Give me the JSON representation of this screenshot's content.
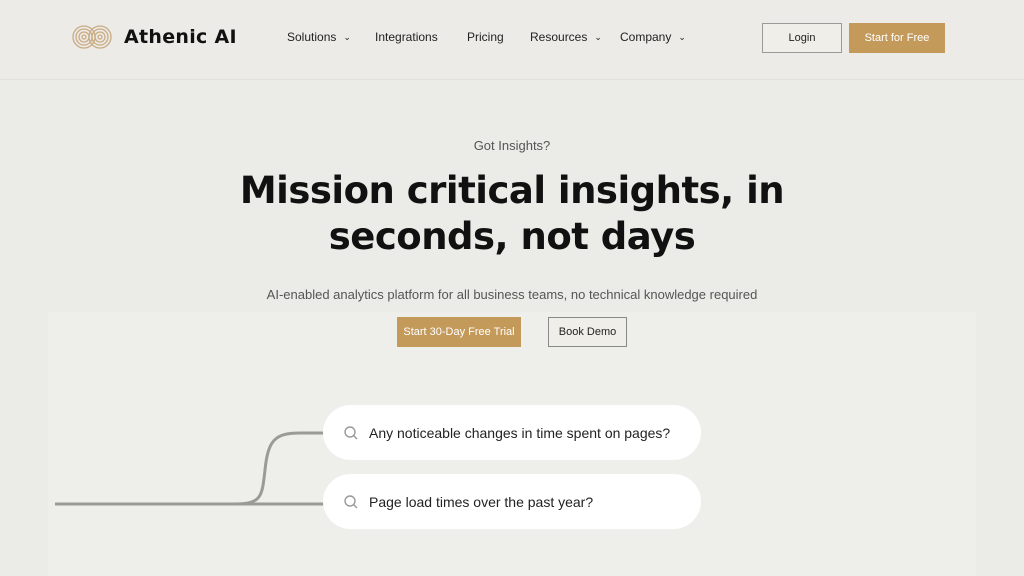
{
  "brand": {
    "name": "Athenic AI",
    "accent": "#c49a5a"
  },
  "nav": [
    {
      "label": "Solutions",
      "dropdown": true
    },
    {
      "label": "Integrations"
    },
    {
      "label": "Pricing"
    },
    {
      "label": "Resources",
      "dropdown": true
    },
    {
      "label": "Company",
      "dropdown": true
    }
  ],
  "header": {
    "login": "Login",
    "start": "Start for Free"
  },
  "hero": {
    "eyebrow": "Got Insights?",
    "title_line1": "Mission critical insights, in",
    "title_line2": "seconds, not days",
    "subtitle": "AI-enabled analytics platform for all business teams, no technical knowledge required",
    "cta_primary": "Start 30-Day Free Trial",
    "cta_secondary": "Book Demo"
  },
  "queries": [
    {
      "icon": "search-icon",
      "text": "Any noticeable changes in time spent on pages?"
    },
    {
      "icon": "search-icon",
      "text": "Page load times over the past year?"
    }
  ]
}
